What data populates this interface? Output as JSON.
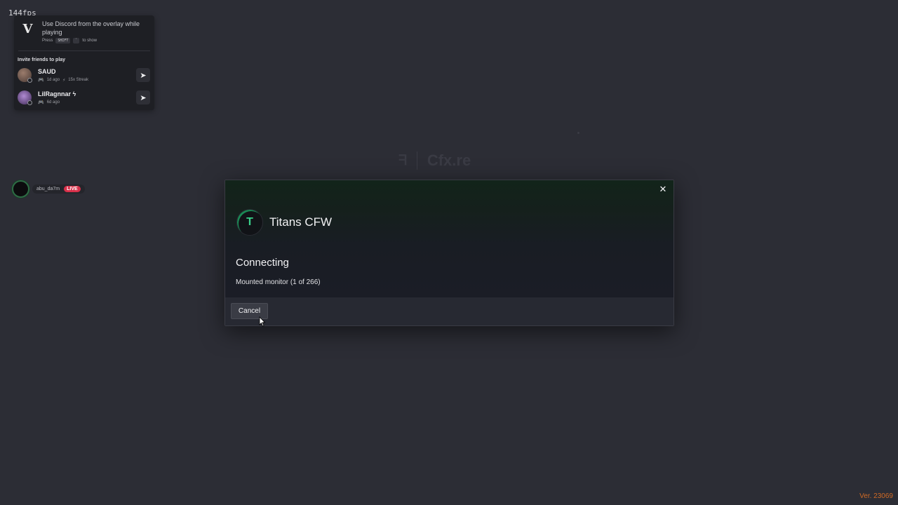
{
  "fps": "144fps",
  "overlay": {
    "title": "Use Discord from the overlay while playing",
    "hint_press": "Press",
    "hint_key1": "SHIFT",
    "hint_key2": "`",
    "hint_to_show": "to show",
    "section_title": "Invite friends to play",
    "friends": [
      {
        "name": "SAUD",
        "last_played": "1d ago",
        "streak": "15x Streak"
      },
      {
        "name": "LilRagnnar ϟ",
        "last_played": "6d ago"
      }
    ]
  },
  "stream": {
    "handle": "abu_da7m",
    "live_label": "LIVE"
  },
  "background": {
    "logo_text": "Cfx.re"
  },
  "modal": {
    "server_name": "Titans CFW",
    "status_title": "Connecting",
    "status_detail": "Mounted monitor (1 of 266)",
    "cancel_label": "Cancel",
    "close_glyph": "✕",
    "logo_glyph": "T"
  },
  "version": "Ver. 23069",
  "colors": {
    "background": "#2c2d35",
    "accent_green": "#3ad08a",
    "live_red": "#d8304a",
    "version_orange": "#d06a25"
  }
}
